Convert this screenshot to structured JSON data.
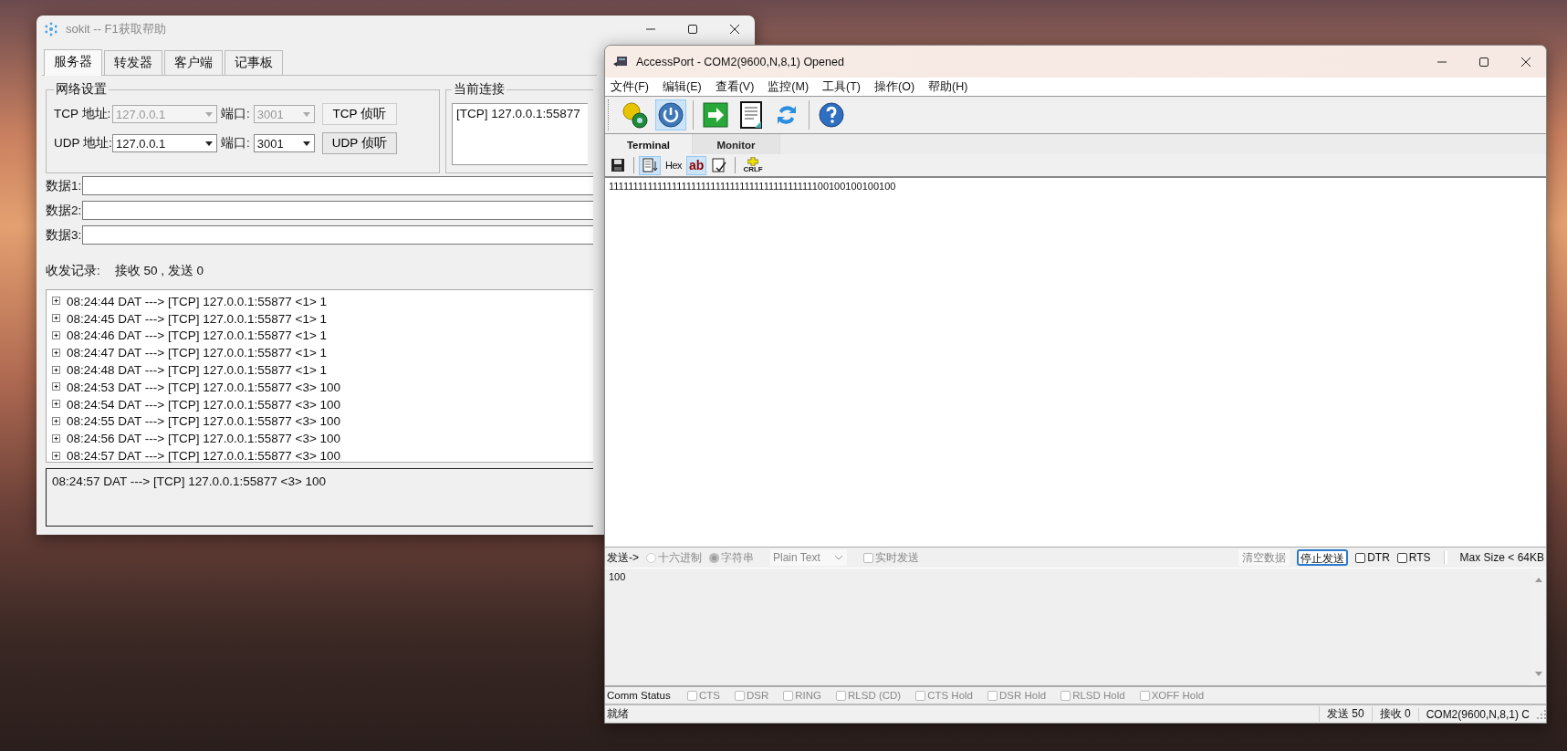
{
  "sokit": {
    "title": "sokit -- F1获取帮助",
    "tabs": [
      {
        "label": "服务器",
        "selected": true
      },
      {
        "label": "转发器",
        "selected": false
      },
      {
        "label": "客户端",
        "selected": false
      },
      {
        "label": "记事板",
        "selected": false
      }
    ],
    "network_settings": {
      "title": "网络设置",
      "rows": [
        {
          "address_label": "TCP 地址:",
          "address": "127.0.0.1",
          "port_label": "端口:",
          "port": "3001",
          "button": "TCP 侦听",
          "disabled": true
        },
        {
          "address_label": "UDP 地址:",
          "address": "127.0.0.1",
          "port_label": "端口:",
          "port": "3001",
          "button": "UDP 侦听",
          "disabled": false
        }
      ]
    },
    "current_connections": {
      "title": "当前连接",
      "items": [
        "[TCP] 127.0.0.1:55877"
      ]
    },
    "data_fields": [
      {
        "label": "数据1:"
      },
      {
        "label": "数据2:"
      },
      {
        "label": "数据3:"
      }
    ],
    "log_label": "收发记录:",
    "log_counts": "接收  50 , 发送  0",
    "log_entries": [
      "08:24:44 DAT ---> [TCP] 127.0.0.1:55877 <1> 1",
      "08:24:45 DAT ---> [TCP] 127.0.0.1:55877 <1> 1",
      "08:24:46 DAT ---> [TCP] 127.0.0.1:55877 <1> 1",
      "08:24:47 DAT ---> [TCP] 127.0.0.1:55877 <1> 1",
      "08:24:48 DAT ---> [TCP] 127.0.0.1:55877 <1> 1",
      "08:24:53 DAT ---> [TCP] 127.0.0.1:55877 <3> 100",
      "08:24:54 DAT ---> [TCP] 127.0.0.1:55877 <3> 100",
      "08:24:55 DAT ---> [TCP] 127.0.0.1:55877 <3> 100",
      "08:24:56 DAT ---> [TCP] 127.0.0.1:55877 <3> 100",
      "08:24:57 DAT ---> [TCP] 127.0.0.1:55877 <3> 100"
    ],
    "log_detail": "08:24:57 DAT ---> [TCP] 127.0.0.1:55877 <3> 100"
  },
  "accessport": {
    "title": "AccessPort - COM2(9600,N,8,1) Opened",
    "menu": [
      "文件(F)",
      "编辑(E)",
      "查看(V)",
      "监控(M)",
      "工具(T)",
      "操作(O)",
      "帮助(H)"
    ],
    "toolbar": [
      {
        "kind": "gears",
        "pressed": false
      },
      {
        "kind": "power",
        "pressed": true
      },
      {
        "kind": "separator"
      },
      {
        "kind": "arrow",
        "pressed": false
      },
      {
        "kind": "document",
        "pressed": false
      },
      {
        "kind": "refresh",
        "pressed": false
      },
      {
        "kind": "separator"
      },
      {
        "kind": "help",
        "pressed": false
      }
    ],
    "tabs": [
      {
        "label": "Terminal",
        "selected": true
      },
      {
        "label": "Monitor",
        "selected": false
      }
    ],
    "terminal_toolbar": [
      {
        "kind": "save",
        "pressed": false
      },
      {
        "kind": "separator"
      },
      {
        "kind": "receive",
        "pressed": true
      },
      {
        "kind": "label",
        "label": "Hex",
        "pressed": false
      },
      {
        "kind": "label-red",
        "label": "ab",
        "pressed": true
      },
      {
        "kind": "edit",
        "pressed": false
      },
      {
        "kind": "separator"
      },
      {
        "kind": "crlf",
        "label": "CRLF",
        "pressed": false
      }
    ],
    "received_text": "111111111111111111111111111111111111111111100100100100100",
    "send_bar": [
      {
        "kind": "label",
        "label": "发送->"
      },
      {
        "kind": "radio",
        "label": "十六进制",
        "selected": false,
        "disabled": true
      },
      {
        "kind": "radio",
        "label": "字符串",
        "selected": true,
        "disabled": true
      },
      {
        "kind": "select",
        "label": "Plain Text",
        "disabled": true
      },
      {
        "kind": "checkbox",
        "label": "实时发送",
        "checked": false,
        "disabled": true
      },
      {
        "kind": "spacer"
      },
      {
        "kind": "button",
        "label": "清空数据",
        "disabled": true,
        "focused": false
      },
      {
        "kind": "button",
        "label": "停止发送",
        "disabled": false,
        "focused": true
      },
      {
        "kind": "checkbox",
        "label": "DTR",
        "checked": false,
        "disabled": false
      },
      {
        "kind": "checkbox",
        "label": "RTS",
        "checked": false,
        "disabled": false
      },
      {
        "kind": "separator"
      },
      {
        "kind": "label",
        "label": "Max Size < 64KB"
      }
    ],
    "send_text": "100",
    "comm_status": {
      "label": "Comm Status",
      "flags": [
        {
          "label": "CTS",
          "checked": false
        },
        {
          "label": "DSR",
          "checked": false
        },
        {
          "label": "RING",
          "checked": false
        },
        {
          "label": "RLSD (CD)",
          "checked": false
        },
        {
          "label": "CTS Hold",
          "checked": false
        },
        {
          "label": "DSR Hold",
          "checked": false
        },
        {
          "label": "RLSD Hold",
          "checked": false
        },
        {
          "label": "XOFF Hold",
          "checked": false
        }
      ]
    },
    "status_bar": [
      "就绪",
      "发送 50",
      "接收 0",
      "COM2(9600,N,8,1) C"
    ]
  }
}
